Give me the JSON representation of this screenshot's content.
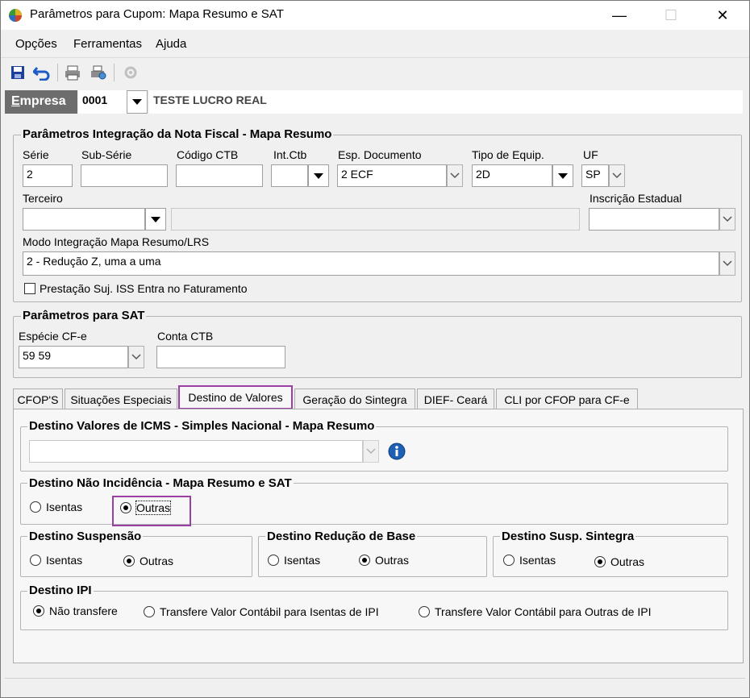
{
  "window": {
    "title": "Parâmetros para Cupom: Mapa Resumo e SAT",
    "minimize": "—",
    "maximize": "☐",
    "close": "✕"
  },
  "menu": [
    "Opções",
    "Ferramentas",
    "Ajuda"
  ],
  "empresa": {
    "label_first": "E",
    "label_rest": "mpresa",
    "code": "0001",
    "name": "TESTE LUCRO REAL"
  },
  "nf_group": {
    "title": "Parâmetros Integração da Nota Fiscal - Mapa Resumo",
    "serie_label": "Série",
    "serie_value": "2",
    "subserie_label": "Sub-Série",
    "subserie_value": "",
    "codctb_label": "Código CTB",
    "codctb_value": "",
    "intctb_label": "Int.Ctb",
    "intctb_value": "",
    "espdoc_label": "Esp. Documento",
    "espdoc_value": "2 ECF",
    "tipoequip_label": "Tipo de Equip.",
    "tipoequip_value": "2D",
    "uf_label": "UF",
    "uf_value": "SP",
    "terceiro_label": "Terceiro",
    "terceiro_value": "",
    "terceiro_name": "",
    "ie_label": "Inscrição Estadual",
    "ie_value": "",
    "modo_label": "Modo Integração Mapa Resumo/LRS",
    "modo_value": "2 - Redução Z, uma a uma",
    "iss_label": "Prestação Suj. ISS Entra no Faturamento"
  },
  "sat_group": {
    "title": "Parâmetros para SAT",
    "especie_label": "Espécie CF-e",
    "especie_value": "59 59",
    "contactb_label": "Conta CTB",
    "contactb_value": ""
  },
  "tabs": [
    "CFOP'S",
    "Situações Especiais",
    "Destino de Valores",
    "Geração do Sintegra",
    "DIEF- Ceará",
    "CLI por CFOP para CF-e"
  ],
  "active_tab": "Destino de Valores",
  "panel": {
    "icms_title": "Destino Valores de ICMS - Simples Nacional - Mapa Resumo",
    "icms_value": "",
    "nao_incid_title": "Destino Não Incidência - Mapa Resumo e SAT",
    "suspensao_title": "Destino Suspensão",
    "reducao_title": "Destino Redução de Base",
    "susp_sint_title": "Destino Susp. Sintegra",
    "isentas": "Isentas",
    "outras": "Outras",
    "ipi_title": "Destino IPI",
    "ipi_opt1": "Não transfere",
    "ipi_opt2": "Transfere Valor Contábil para Isentas de IPI",
    "ipi_opt3": "Transfere Valor Contábil para Outras de IPI"
  },
  "colors": {
    "highlight": "#9b3fa3",
    "empresa_bg": "#6d6d6d",
    "info_blue": "#1f5fb4"
  }
}
